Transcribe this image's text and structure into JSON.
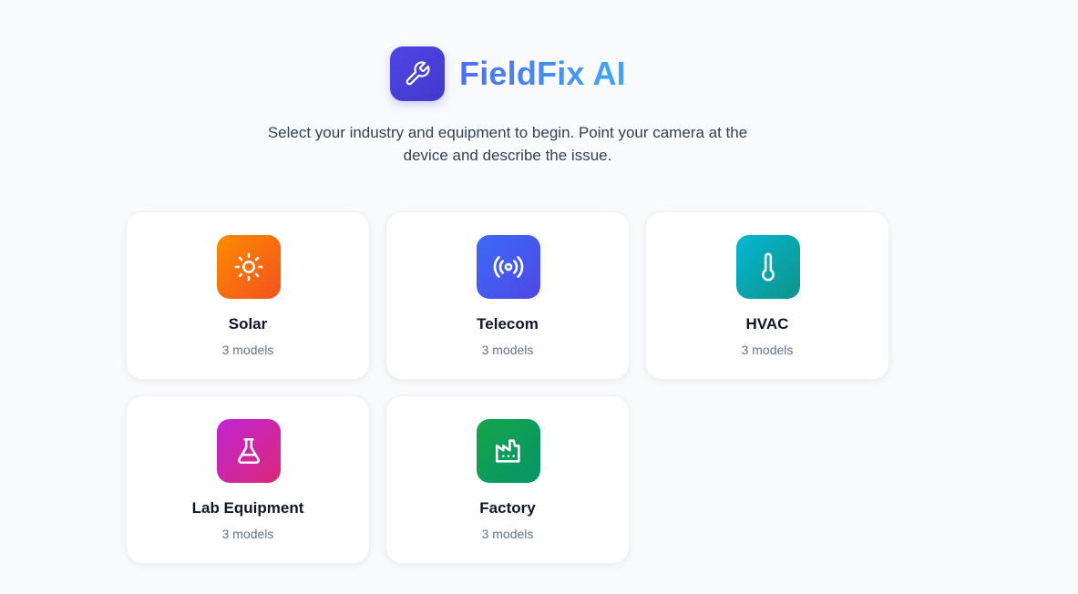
{
  "brand": {
    "title": "FieldFix AI",
    "icon": "wrench-icon",
    "color": "#4f46e5"
  },
  "subtitle": "Select your industry and equipment to begin. Point your camera at the device and describe the issue.",
  "industries": [
    {
      "name": "Solar",
      "models": "3 models",
      "icon": "sun-icon",
      "gradient": [
        "#fb8c00",
        "#f4511e"
      ]
    },
    {
      "name": "Telecom",
      "models": "3 models",
      "icon": "broadcast-icon",
      "gradient": [
        "#3b6cf6",
        "#4f46e5"
      ]
    },
    {
      "name": "HVAC",
      "models": "3 models",
      "icon": "thermometer-icon",
      "gradient": [
        "#06b6d4",
        "#0d9488"
      ]
    },
    {
      "name": "Lab Equipment",
      "models": "3 models",
      "icon": "flask-icon",
      "gradient": [
        "#c026d3",
        "#db2777"
      ]
    },
    {
      "name": "Factory",
      "models": "3 models",
      "icon": "factory-icon",
      "gradient": [
        "#16a34a",
        "#059669"
      ]
    }
  ]
}
